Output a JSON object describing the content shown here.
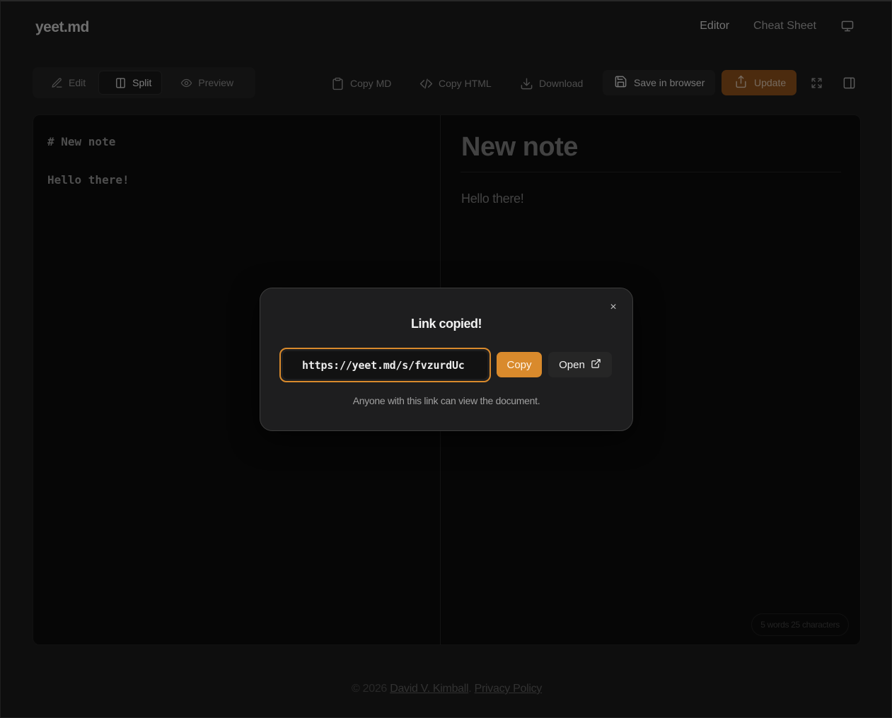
{
  "header": {
    "logo": "yeet.md",
    "nav": {
      "editor": "Editor",
      "cheatsheet": "Cheat Sheet",
      "theme_icon": "monitor-icon"
    }
  },
  "toolbar": {
    "view_modes": [
      {
        "label": "Edit",
        "icon": "pencil-icon",
        "active": false
      },
      {
        "label": "Split",
        "icon": "columns-icon",
        "active": true
      },
      {
        "label": "Preview",
        "icon": "eye-icon",
        "active": false
      }
    ],
    "copy_md": "Copy MD",
    "copy_html": "Copy HTML",
    "download": "Download",
    "save_browser": "Save in browser",
    "update": "Update",
    "fullscreen_icon": "expand-icon",
    "sidebar_icon": "sidebar-icon"
  },
  "editor": {
    "line1": "# New note",
    "line2": "",
    "line3": "Hello there!"
  },
  "preview": {
    "title": "New note",
    "body": "Hello there!"
  },
  "stats": {
    "text": "5 words 25 characters"
  },
  "footer": {
    "copyright": "© 2026",
    "author": "David V. Kimball",
    "separator": ".",
    "privacy": "Privacy Policy"
  },
  "modal": {
    "title": "Link copied!",
    "url": "https://yeet.md/s/fvzurdUc",
    "copy": "Copy",
    "open": "Open",
    "note": "Anyone with this link can view the document.",
    "close": "×"
  },
  "colors": {
    "accent": "#d98a2c",
    "accent_dim": "#8a4f1a",
    "background": "#181818"
  }
}
